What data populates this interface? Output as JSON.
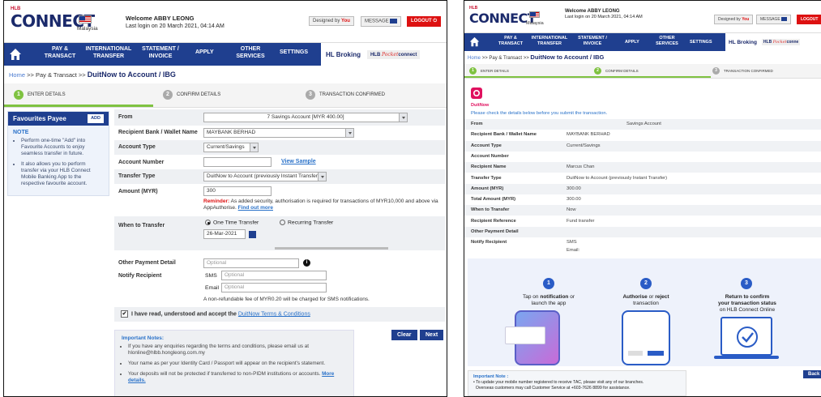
{
  "left": {
    "header": {
      "brand_small": "HLB",
      "brand": "CONNECT",
      "country": "Malaysia",
      "welcome": "Welcome ABBY LEONG",
      "last_login": "Last login on 20 March 2021, 04:14 AM",
      "designed_by": "Designed by",
      "designed_you": "You",
      "message": "MESSAGE",
      "logout": "LOGOUT"
    },
    "nav": {
      "items": [
        "PAY & TRANSACT",
        "INTERNATIONAL TRANSFER",
        "STATEMENT / INVOICE",
        "APPLY",
        "OTHER SERVICES",
        "SETTINGS"
      ],
      "broking": "HL Broking",
      "pocket_a": "HLB",
      "pocket_b": "Pocket",
      "pocket_c": "connect"
    },
    "breadcrumb": {
      "home": "Home",
      "sep": ">>",
      "pay": "Pay & Transact",
      "page": "DuitNow to Account / IBG"
    },
    "steps": [
      {
        "n": "1",
        "label": "ENTER DETAILS"
      },
      {
        "n": "2",
        "label": "CONFIRM DETAILS"
      },
      {
        "n": "3",
        "label": "TRANSACTION CONFIRMED"
      }
    ],
    "favourites": {
      "title": "Favourites Payee",
      "add": "ADD",
      "note_title": "NOTE",
      "notes": [
        "Perform one-time \"Add\" into Favourite Accounts to enjoy seamless transfer in future.",
        "It also allows you to perform transfer via your HLB Connect Mobile Banking App to the respective favourite account."
      ]
    },
    "form": {
      "from_label": "From",
      "from_value": "7 Savings Account [MYR 400.00]",
      "bank_label": "Recipient Bank / Wallet Name",
      "bank_value": "MAYBANK BERHAD",
      "acct_type_label": "Account Type",
      "acct_type_value": "Current/Savings",
      "acct_no_label": "Account Number",
      "view_sample": "View Sample",
      "transfer_type_label": "Transfer Type",
      "transfer_type_value": "DuitNow to Account (previously Instant Transfer)",
      "amount_label": "Amount (MYR)",
      "amount_value": "300",
      "reminder_bold": "Reminder:",
      "reminder_text": "As added security, authorisation is required for transactions of MYR10,000 and above via AppAuthorise.",
      "find_out": "Find out more",
      "when_label": "When to Transfer",
      "one_time": "One Time Transfer",
      "recurring": "Recurring Transfer",
      "date": "26-Mar-2021",
      "other_label": "Other Payment Detail",
      "other_ph": "Optional",
      "notify_label": "Notify Recipient",
      "sms": "SMS",
      "email": "Email",
      "sms_ph": "Optional",
      "email_ph": "Optional",
      "fee": "A non-refundable fee of MYR0.20 will be charged for SMS notifications.",
      "accept_text": "I have read, understood and accept the",
      "accept_link": "DuitNow Terms & Conditions",
      "clear": "Clear",
      "next": "Next"
    },
    "important": {
      "title": "Important Notes:",
      "items": [
        "If you have any enquiries regarding the terms and conditions, please email us at hlonline@hlbb.hongleong.com.my",
        "Your name as per your Identity Card / Passport will appear on the recipient's statement.",
        "Your deposits will not be protected if transferred to non-PIDM institutions or accounts."
      ],
      "more": "More details."
    }
  },
  "right": {
    "header": {
      "brand_small": "HLB",
      "brand": "CONNECT",
      "country": "Malaysia",
      "welcome": "Welcome ABBY LEONG",
      "last_login": "Last login on 20 March 2021, 04:14 AM",
      "designed_by": "Designed by",
      "designed_you": "You",
      "message": "MESSAGE",
      "logout": "LOGOUT"
    },
    "nav": {
      "items": [
        "PAY & TRANSACT",
        "INTERNATIONAL TRANSFER",
        "STATEMENT / INVOICE",
        "APPLY",
        "OTHER SERVICES",
        "SETTINGS"
      ],
      "broking": "HL Broking",
      "pocket_a": "HLB",
      "pocket_b": "Pocket",
      "pocket_c": "conne"
    },
    "breadcrumb": {
      "home": "Home",
      "sep": ">>",
      "pay": "Pay & Transact",
      "page": "DuitNow to Account / IBG"
    },
    "steps": [
      {
        "n": "1",
        "label": "ENTER DETAILS"
      },
      {
        "n": "2",
        "label": "CONFIRM DETAILS"
      },
      {
        "n": "3",
        "label": "TRANSACTION CONFIRMED"
      }
    ],
    "duitnow": "DuitNow",
    "check_msg": "Please check the details below before you submit the transaction.",
    "details": [
      {
        "label": "From",
        "value": "Savings Account"
      },
      {
        "label": "Recipient Bank / Wallet Name",
        "value": "MAYBANK BERHAD"
      },
      {
        "label": "Account Type",
        "value": "Current/Savings"
      },
      {
        "label": "Account Number",
        "value": ""
      },
      {
        "label": "Recipient Name",
        "value": "Marcus Chan"
      },
      {
        "label": "Transfer Type",
        "value": "DuitNow to Account (previously Instant Transfer)"
      },
      {
        "label": "Amount (MYR)",
        "value": "300.00"
      },
      {
        "label": "Total Amount (MYR)",
        "value": "300.00"
      },
      {
        "label": "When to Transfer",
        "value": "Now"
      },
      {
        "label": "Recipient Reference",
        "value": "Fund transfer"
      },
      {
        "label": "Other Payment Detail",
        "value": ""
      },
      {
        "label": "Notify Recipient",
        "value": "SMS"
      }
    ],
    "notify_email": "Email:",
    "steps_illus": [
      {
        "n": "1",
        "a": "Tap on",
        "b": "notification",
        "c": "or",
        "d": "launch the app"
      },
      {
        "n": "2",
        "a": "Authorise",
        "b": "or",
        "c": "reject",
        "d": "transaction"
      },
      {
        "n": "3",
        "a": "Return to confirm",
        "b": "your transaction status",
        "c": "on HLB Connect Online",
        "d": ""
      }
    ],
    "important": {
      "title": "Important Note :",
      "items": [
        "To update your mobile number registered to receive TAC, please visit any of our branches.",
        "Overseas customers may call Customer Service at +603-7626 8899 for assistance."
      ]
    },
    "back": "Back"
  },
  "colors": {
    "navy": "#1f3f8f",
    "red": "#dd1111",
    "green": "#7fc241",
    "link": "#2a72c9"
  }
}
